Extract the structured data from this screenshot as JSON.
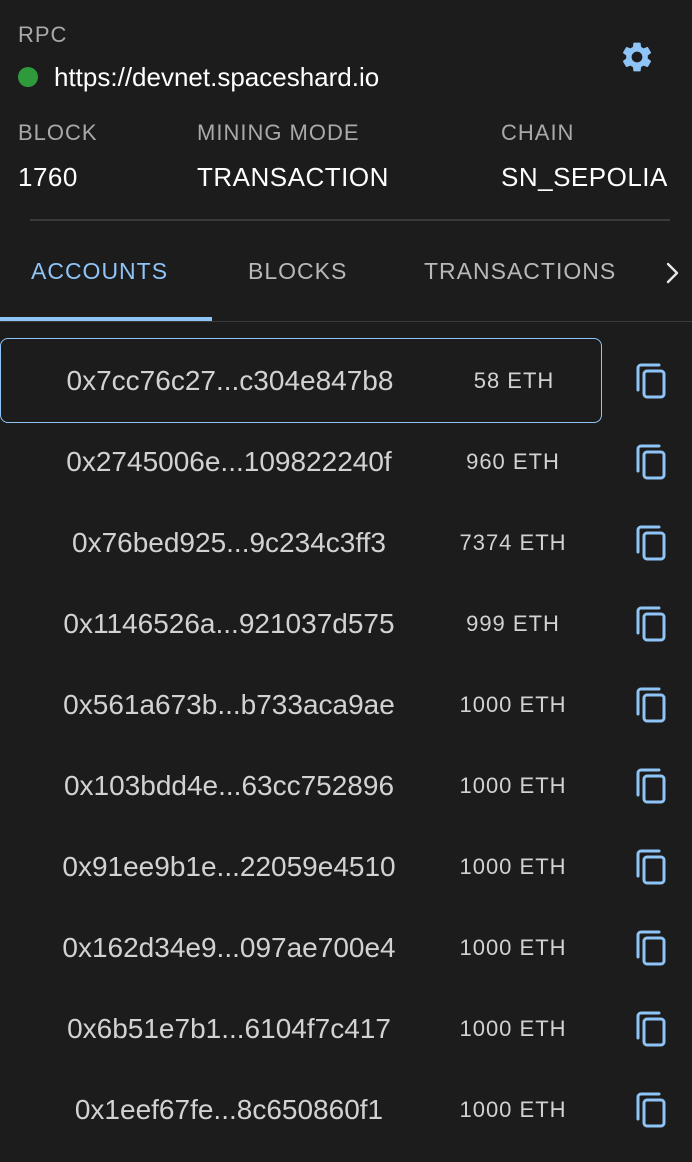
{
  "rpc": {
    "label": "RPC",
    "url": "https://devnet.spaceshard.io",
    "status_color": "#2f9a3c"
  },
  "stats": {
    "block_label": "BLOCK",
    "block_value": "1760",
    "mining_label": "MINING MODE",
    "mining_value": "TRANSACTION",
    "chain_label": "CHAIN",
    "chain_value": "SN_SEPOLIA"
  },
  "tabs": [
    {
      "label": "ACCOUNTS",
      "active": true
    },
    {
      "label": "BLOCKS",
      "active": false
    },
    {
      "label": "TRANSACTIONS",
      "active": false
    }
  ],
  "accent_color": "#8fc4f6",
  "accounts": [
    {
      "address": "0x7cc76c27...c304e847b8",
      "balance": "58 ETH",
      "selected": true
    },
    {
      "address": "0x2745006e...109822240f",
      "balance": "960 ETH",
      "selected": false
    },
    {
      "address": "0x76bed925...9c234c3ff3",
      "balance": "7374 ETH",
      "selected": false
    },
    {
      "address": "0x1146526a...921037d575",
      "balance": "999 ETH",
      "selected": false
    },
    {
      "address": "0x561a673b...b733aca9ae",
      "balance": "1000 ETH",
      "selected": false
    },
    {
      "address": "0x103bdd4e...63cc752896",
      "balance": "1000 ETH",
      "selected": false
    },
    {
      "address": "0x91ee9b1e...22059e4510",
      "balance": "1000 ETH",
      "selected": false
    },
    {
      "address": "0x162d34e9...097ae700e4",
      "balance": "1000 ETH",
      "selected": false
    },
    {
      "address": "0x6b51e7b1...6104f7c417",
      "balance": "1000 ETH",
      "selected": false
    },
    {
      "address": "0x1eef67fe...8c650860f1",
      "balance": "1000 ETH",
      "selected": false
    }
  ],
  "icons": {
    "settings": "gear-icon",
    "tab_next": "chevron-right-icon",
    "copy": "copy-icon"
  }
}
